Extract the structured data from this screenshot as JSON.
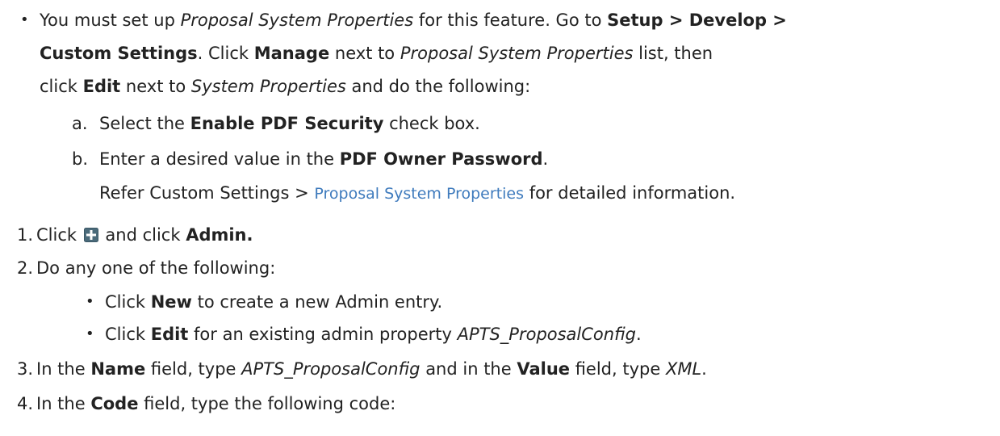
{
  "prereq": {
    "bullet": "•",
    "line1": {
      "a": "You must set up ",
      "b": "Proposal System Properties",
      "c": " for this feature. Go to ",
      "d": "Setup > Develop >"
    },
    "line2": {
      "a": "Custom Settings",
      "b": ". Click ",
      "c": "Manage",
      "d": " next to ",
      "e": "Proposal System Properties",
      "f": " list, then"
    },
    "line3": {
      "a": "click ",
      "b": "Edit",
      "c": " next to ",
      "d": "System Properties",
      "e": " and do the following:"
    },
    "subs": [
      {
        "marker": "a.",
        "a": "Select the ",
        "b": "Enable PDF Security",
        "c": " check box."
      },
      {
        "marker": "b.",
        "a": "Enter a desired value in the ",
        "b": "PDF Owner Password",
        "c": "."
      }
    ],
    "refer": {
      "a": "Refer Custom Settings > ",
      "link": "Proposal System Properties",
      "b": " for detailed information."
    }
  },
  "steps": [
    {
      "marker": "1.",
      "a": "Click ",
      "icon": "plus-icon",
      "b": " and click ",
      "c": "Admin."
    },
    {
      "marker": "2.",
      "a": "Do any one of the following:"
    },
    {
      "marker": "3.",
      "a": "In the ",
      "b": "Name",
      "c": " field, type ",
      "d": "APTS_ProposalConfig",
      "e": " and in the ",
      "f": "Value",
      "g": " field, type ",
      "h": "XML",
      "i": "."
    },
    {
      "marker": "4.",
      "a": "In the ",
      "b": "Code",
      "c": " field, type the following code:"
    }
  ],
  "step2_items": [
    {
      "bullet": "•",
      "a": "Click ",
      "b": "New",
      "c": " to create a new Admin entry."
    },
    {
      "bullet": "•",
      "a": "Click ",
      "b": "Edit",
      "c": " for an existing admin property ",
      "d": "APTS_ProposalConfig",
      "e": "."
    }
  ],
  "colors": {
    "text": "#222222",
    "link": "#3f7bbd",
    "icon_bg": "#4a6a7a"
  }
}
